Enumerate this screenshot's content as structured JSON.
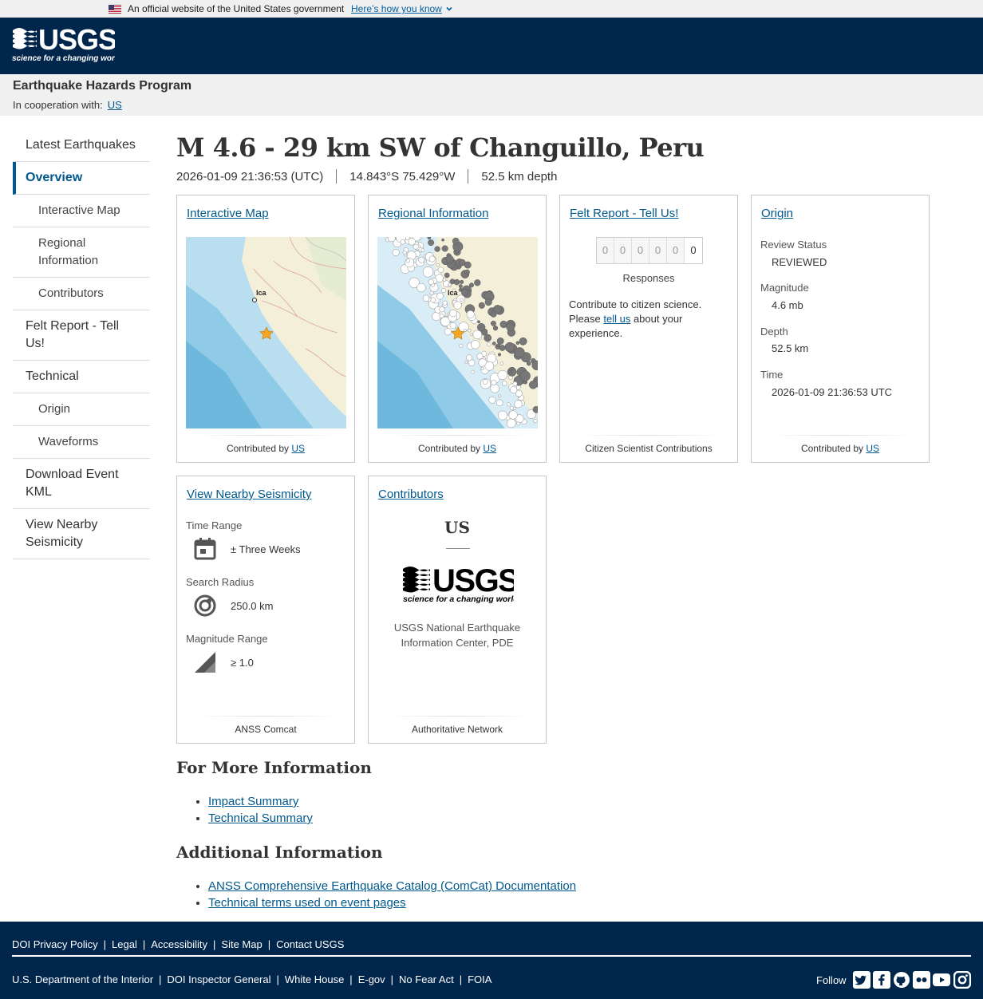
{
  "gov_banner": {
    "text": "An official website of the United States government",
    "link": "Here’s how you know"
  },
  "program": {
    "title": "Earthquake Hazards Program",
    "coop_label": "In cooperation with:",
    "coop_link": "US"
  },
  "sidebar": {
    "items": [
      {
        "label": "Latest Earthquakes"
      },
      {
        "label": "Overview"
      },
      {
        "label": "Interactive Map"
      },
      {
        "label": "Regional Information"
      },
      {
        "label": "Contributors"
      },
      {
        "label": "Felt Report - Tell Us!"
      },
      {
        "label": "Technical"
      },
      {
        "label": "Origin"
      },
      {
        "label": "Waveforms"
      },
      {
        "label": "Download Event KML"
      },
      {
        "label": "View Nearby Seismicity"
      }
    ]
  },
  "event": {
    "title": "M 4.6 - 29 km SW of Changuillo, Peru",
    "time": "2026-01-09 21:36:53 (UTC)",
    "location": "14.843°S 75.429°W",
    "depth": "52.5 km depth"
  },
  "cards": {
    "interactive_map": {
      "title": "Interactive Map",
      "footer_prefix": "Contributed by",
      "footer_link": "US",
      "map_label": "Ica"
    },
    "regional": {
      "title": "Regional Information",
      "footer_prefix": "Contributed by",
      "footer_link": "US",
      "map_label": "Ica"
    },
    "felt": {
      "title": "Felt Report - Tell Us!",
      "digits": [
        "0",
        "0",
        "0",
        "0",
        "0",
        "0"
      ],
      "responses": "Responses",
      "text_before": "Contribute to citizen science. Please ",
      "text_link": "tell us",
      "text_after": " about your experience.",
      "footer": "Citizen Scientist Contributions"
    },
    "origin": {
      "title": "Origin",
      "review_label": "Review Status",
      "review_value": "REVIEWED",
      "mag_label": "Magnitude",
      "mag_value": "4.6 mb",
      "depth_label": "Depth",
      "depth_value": "52.5 km",
      "time_label": "Time",
      "time_value": "2026-01-09 21:36:53 UTC",
      "footer_prefix": "Contributed by",
      "footer_link": "US"
    },
    "seismicity": {
      "title": "View Nearby Seismicity",
      "time_label": "Time Range",
      "time_value": "± Three Weeks",
      "radius_label": "Search Radius",
      "radius_value": "250.0 km",
      "mag_label": "Magnitude Range",
      "mag_value": "≥ 1.0",
      "footer": "ANSS Comcat"
    },
    "contributors": {
      "title": "Contributors",
      "network": "US",
      "name": "USGS National Earthquake Information Center, PDE",
      "footer": "Authoritative Network"
    }
  },
  "more_info": {
    "heading": "For More Information",
    "links": [
      "Impact Summary",
      "Technical Summary"
    ]
  },
  "additional_info": {
    "heading": "Additional Information",
    "links": [
      "ANSS Comprehensive Earthquake Catalog (ComCat) Documentation",
      "Technical terms used on event pages"
    ]
  },
  "footer": {
    "row1": [
      "DOI Privacy Policy",
      "Legal",
      "Accessibility",
      "Site Map",
      "Contact USGS"
    ],
    "row2": [
      "U.S. Department of the Interior",
      "DOI Inspector General",
      "White House",
      "E-gov",
      "No Fear Act",
      "FOIA"
    ],
    "follow": "Follow",
    "social_icons": [
      "twitter-icon",
      "facebook-icon",
      "github-icon",
      "flickr-icon",
      "youtube-icon",
      "instagram-icon"
    ]
  },
  "logo": {
    "word": "USGS",
    "tagline": "science for a changing world"
  },
  "colors": {
    "header_bg": "#00264c",
    "link": "#00588d",
    "banner_bg": "#f0f0f0",
    "star": "#f5a623"
  }
}
